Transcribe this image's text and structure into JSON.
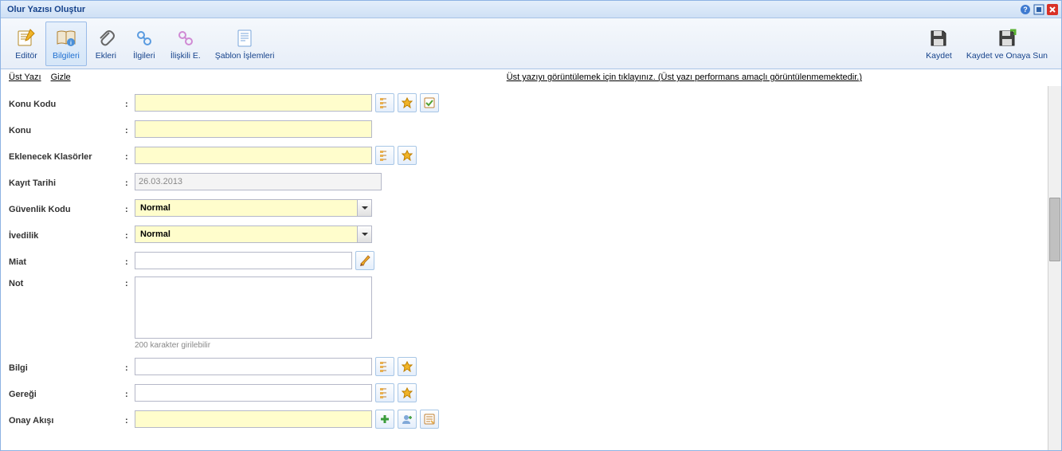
{
  "window": {
    "title": "Olur Yazısı Oluştur"
  },
  "toolbar": {
    "editor": "Editör",
    "bilgileri": "Bilgileri",
    "ekleri": "Ekleri",
    "ilgileri": "İlgileri",
    "iliskili": "İlişkili E.",
    "sablon": "Şablon İşlemleri",
    "kaydet": "Kaydet",
    "kaydet_onaya": "Kaydet ve Onaya Sun"
  },
  "subbar": {
    "ust_yazi": "Üst Yazı",
    "gizle": "Gizle",
    "hint": "Üst yazıyı görüntülemek için tıklayınız. (Üst yazı performans amaçlı görüntülenmemektedir.)"
  },
  "form": {
    "konu_kodu": {
      "label": "Konu Kodu",
      "value": ""
    },
    "konu": {
      "label": "Konu",
      "value": ""
    },
    "eklenecek": {
      "label": "Eklenecek Klasörler",
      "value": ""
    },
    "kayit_tarihi": {
      "label": "Kayıt Tarihi",
      "value": "26.03.2013"
    },
    "guvenlik": {
      "label": "Güvenlik Kodu",
      "value": "Normal"
    },
    "ivedilik": {
      "label": "İvedilik",
      "value": "Normal"
    },
    "miat": {
      "label": "Miat",
      "value": ""
    },
    "not": {
      "label": "Not",
      "value": "",
      "hint": "200 karakter girilebilir"
    },
    "bilgi": {
      "label": "Bilgi",
      "value": ""
    },
    "geregi": {
      "label": "Gereği",
      "value": ""
    },
    "onay_akisi": {
      "label": "Onay Akışı",
      "value": ""
    }
  }
}
